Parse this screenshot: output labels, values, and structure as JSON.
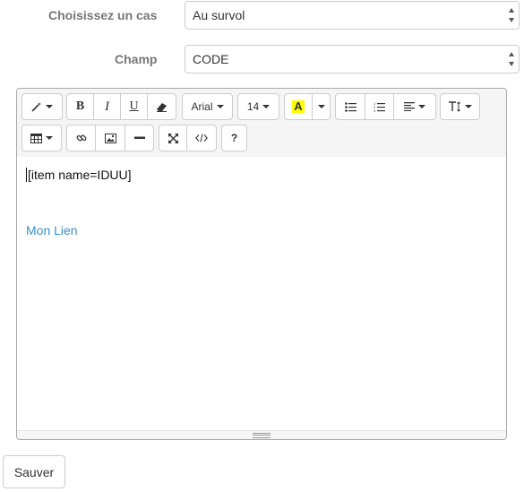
{
  "form": {
    "case_label": "Choisissez un cas",
    "case_value": "Au survol",
    "field_label": "Champ",
    "field_value": "CODE"
  },
  "toolbar": {
    "font_name": "Arial",
    "font_size": "14",
    "bold": "B",
    "italic": "I",
    "underline": "U",
    "help": "?",
    "highlight_color": "#ffff00",
    "icons": [
      "magic-icon",
      "bold-icon",
      "italic-icon",
      "underline-icon",
      "eraser-icon",
      "font-name-dropdown",
      "font-size-dropdown",
      "color-icon",
      "unordered-list-icon",
      "ordered-list-icon",
      "align-icon",
      "text-height-icon",
      "table-icon",
      "link-icon",
      "picture-icon",
      "horizontal-rule-icon",
      "fullscreen-icon",
      "code-view-icon",
      "help-icon"
    ]
  },
  "editor": {
    "line1": "[item name=IDUU]",
    "link_text": "Mon Lien",
    "link_color": "#3b8ec8"
  },
  "actions": {
    "save_label": "Sauver"
  }
}
